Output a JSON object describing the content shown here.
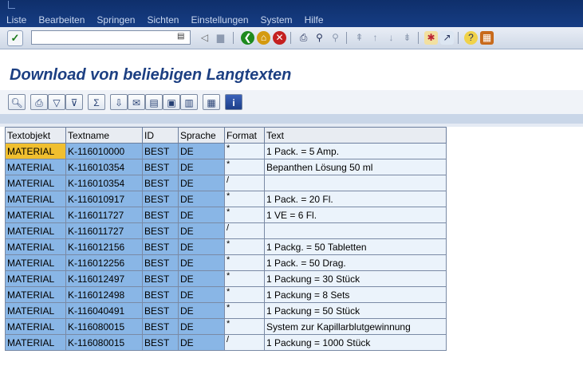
{
  "menubar": {
    "items": [
      "Liste",
      "Bearbeiten",
      "Springen",
      "Sichten",
      "Einstellungen",
      "System",
      "Hilfe"
    ]
  },
  "toolbar": {
    "command_value": "",
    "ok_icon": "check-icon"
  },
  "page": {
    "title": "Download von beliebigen Langtexten"
  },
  "table": {
    "headers": [
      "Textobjekt",
      "Textname",
      "ID",
      "Sprache",
      "Format",
      "Text"
    ],
    "rows": [
      [
        "MATERIAL",
        "K-116010000",
        "BEST",
        "DE",
        "*",
        "1 Pack. = 5 Amp."
      ],
      [
        "MATERIAL",
        "K-116010354",
        "BEST",
        "DE",
        "*",
        "Bepanthen Lösung 50 ml"
      ],
      [
        "MATERIAL",
        "K-116010354",
        "BEST",
        "DE",
        "/",
        ""
      ],
      [
        "MATERIAL",
        "K-116010917",
        "BEST",
        "DE",
        "*",
        "1 Pack. = 20 Fl."
      ],
      [
        "MATERIAL",
        "K-116011727",
        "BEST",
        "DE",
        "*",
        "1 VE = 6 Fl."
      ],
      [
        "MATERIAL",
        "K-116011727",
        "BEST",
        "DE",
        "/",
        ""
      ],
      [
        "MATERIAL",
        "K-116012156",
        "BEST",
        "DE",
        "*",
        "1 Packg. = 50 Tabletten"
      ],
      [
        "MATERIAL",
        "K-116012256",
        "BEST",
        "DE",
        "*",
        "1 Pack. = 50 Drag."
      ],
      [
        "MATERIAL",
        "K-116012497",
        "BEST",
        "DE",
        "*",
        "1 Packung = 30 Stück"
      ],
      [
        "MATERIAL",
        "K-116012498",
        "BEST",
        "DE",
        "*",
        "1 Packung = 8 Sets"
      ],
      [
        "MATERIAL",
        "K-116040491",
        "BEST",
        "DE",
        "*",
        "1 Packung = 50 Stück"
      ],
      [
        "MATERIAL",
        "K-116080015",
        "BEST",
        "DE",
        "*",
        "System zur Kapillarblutgewinnung"
      ],
      [
        "MATERIAL",
        "K-116080015",
        "BEST",
        "DE",
        "/",
        "1 Packung = 1000 Stück"
      ]
    ],
    "selected_row": 0
  },
  "colors": {
    "menubar_bg": "#163d84",
    "title_color": "#1c3f82",
    "key_cell_bg": "#89b6e6",
    "data_cell_bg": "#ebf3fb",
    "selected_cell_bg": "#f0bf2f"
  }
}
